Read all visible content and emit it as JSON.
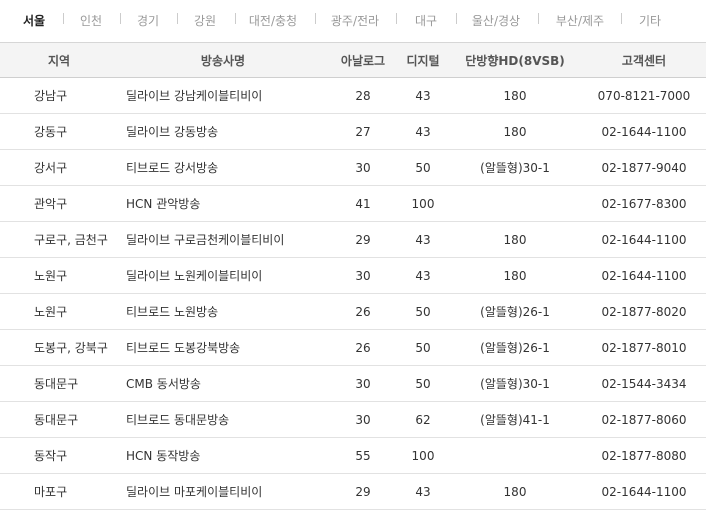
{
  "tabs": [
    "서울",
    "인천",
    "경기",
    "강원",
    "대전/충청",
    "광주/전라",
    "대구",
    "울산/경상",
    "부산/제주",
    "기타"
  ],
  "active_tab": "서울",
  "table": {
    "headers": [
      "지역",
      "방송사명",
      "아날로그",
      "디지털",
      "단방향HD(8VSB)",
      "고객센터"
    ],
    "rows": [
      [
        "강남구",
        "딜라이브 강남케이블티비이",
        "28",
        "43",
        "180",
        "070-8121-7000"
      ],
      [
        "강동구",
        "딜라이브 강동방송",
        "27",
        "43",
        "180",
        "02-1644-1100"
      ],
      [
        "강서구",
        "티브로드 강서방송",
        "30",
        "50",
        "(알뜰형)30-1",
        "02-1877-9040"
      ],
      [
        "관악구",
        "HCN 관악방송",
        "41",
        "100",
        "",
        "02-1677-8300"
      ],
      [
        "구로구, 금천구",
        "딜라이브 구로금천케이블티비이",
        "29",
        "43",
        "180",
        "02-1644-1100"
      ],
      [
        "노원구",
        "딜라이브 노원케이블티비이",
        "30",
        "43",
        "180",
        "02-1644-1100"
      ],
      [
        "노원구",
        "티브로드 노원방송",
        "26",
        "50",
        "(알뜰형)26-1",
        "02-1877-8020"
      ],
      [
        "도봉구, 강북구",
        "티브로드 도봉강북방송",
        "26",
        "50",
        "(알뜰형)26-1",
        "02-1877-8010"
      ],
      [
        "동대문구",
        "CMB 동서방송",
        "30",
        "50",
        "(알뜰형)30-1",
        "02-1544-3434"
      ],
      [
        "동대문구",
        "티브로드 동대문방송",
        "30",
        "62",
        "(알뜰형)41-1",
        "02-1877-8060"
      ],
      [
        "동작구",
        "HCN 동작방송",
        "55",
        "100",
        "",
        "02-1877-8080"
      ],
      [
        "마포구",
        "딜라이브 마포케이블티비이",
        "29",
        "43",
        "180",
        "02-1644-1100"
      ]
    ]
  }
}
